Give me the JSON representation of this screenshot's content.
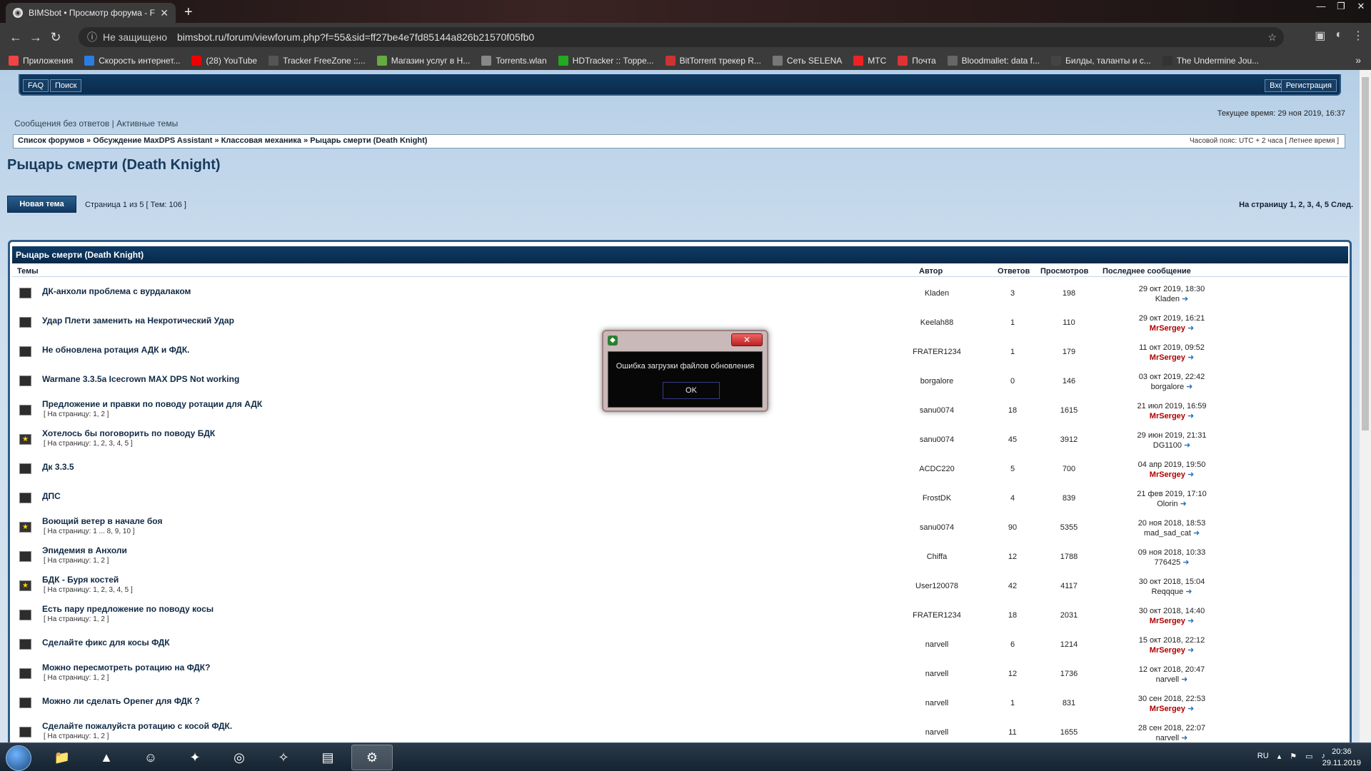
{
  "browser": {
    "tab_title": "BIMSbot • Просмотр форума - F",
    "security": "Не защищено",
    "url": "bimsbot.ru/forum/viewforum.php?f=55&sid=ff27be4e7fd85144a826b21570f05fb0",
    "bookmarks": [
      {
        "label": "Приложения",
        "icon": "apps-icon",
        "color": "#e44"
      },
      {
        "label": "Скорость интернет...",
        "icon": "speed-icon",
        "color": "#2a7de1"
      },
      {
        "label": "(28) YouTube",
        "icon": "youtube-icon",
        "color": "#e00"
      },
      {
        "label": "Tracker FreeZone ::...",
        "icon": "tracker-icon",
        "color": "#555"
      },
      {
        "label": "Магазин услуг в H...",
        "icon": "shop-icon",
        "color": "#6a4"
      },
      {
        "label": "Torrents.wlan",
        "icon": "torrent-icon",
        "color": "#888"
      },
      {
        "label": "HDTracker :: Торре...",
        "icon": "hd-icon",
        "color": "#2a2"
      },
      {
        "label": "BitTorrent трекер R...",
        "icon": "bittorrent-icon",
        "color": "#c33"
      },
      {
        "label": "Сеть SELENA",
        "icon": "selena-icon",
        "color": "#777"
      },
      {
        "label": "МТС",
        "icon": "mts-icon",
        "color": "#e22"
      },
      {
        "label": "Почта",
        "icon": "mail-icon",
        "color": "#d33"
      },
      {
        "label": "Bloodmallet: data f...",
        "icon": "bloodmallet-icon",
        "color": "#666"
      },
      {
        "label": "Билды, таланты и с...",
        "icon": "wg-icon",
        "color": "#444"
      },
      {
        "label": "The Undermine Jou...",
        "icon": "undermine-icon",
        "color": "#333"
      }
    ]
  },
  "forum": {
    "faq": "FAQ",
    "search": "Поиск",
    "login": "Вход",
    "register": "Регистрация",
    "links": "Сообщения без ответов | Активные темы",
    "current_time": "Текущее время: 29 ноя 2019, 16:37",
    "breadcrumb": "Список форумов » Обсуждение MaxDPS Assistant » Классовая механика » Рыцарь смерти (Death Knight)",
    "timezone": "Часовой пояс: UTC + 2 часа [ Летнее время ]",
    "title": "Рыцарь смерти (Death Knight)",
    "new_topic": "Новая тема",
    "page_info": "Страница 1 из 5 [ Тем: 106 ]",
    "pagination": "На страницу 1, 2, 3, 4, 5  След.",
    "box_title": "Рыцарь смерти (Death Knight)",
    "cols": {
      "topics": "Темы",
      "author": "Автор",
      "replies": "Ответов",
      "views": "Просмотров",
      "last": "Последнее сообщение"
    },
    "topics": [
      {
        "title": "ДК-анхоли проблема с вурдалаком",
        "sub": "",
        "author": "Kladen",
        "replies": "3",
        "views": "198",
        "date": "29 окт 2019, 18:30",
        "user": "Kladen",
        "red": false,
        "star": false
      },
      {
        "title": "Удар Плети заменить на Некротический Удар",
        "sub": "",
        "author": "Keelah88",
        "replies": "1",
        "views": "110",
        "date": "29 окт 2019, 16:21",
        "user": "MrSergey",
        "red": true,
        "star": false
      },
      {
        "title": "Не обновлена ротация АДК и ФДК.",
        "sub": "",
        "author": "FRATER1234",
        "replies": "1",
        "views": "179",
        "date": "11 окт 2019, 09:52",
        "user": "MrSergey",
        "red": true,
        "star": false
      },
      {
        "title": "Warmane 3.3.5a Icecrown MAX DPS Not working",
        "sub": "",
        "author": "borgalore",
        "replies": "0",
        "views": "146",
        "date": "03 окт 2019, 22:42",
        "user": "borgalore",
        "red": false,
        "star": false
      },
      {
        "title": "Предложение и правки по поводу ротации для АДК",
        "sub": "[ На страницу: 1, 2 ]",
        "author": "sanu0074",
        "replies": "18",
        "views": "1615",
        "date": "21 июл 2019, 16:59",
        "user": "MrSergey",
        "red": true,
        "star": false
      },
      {
        "title": "Хотелось бы поговорить по поводу БДК",
        "sub": "[ На страницу: 1, 2, 3, 4, 5 ]",
        "author": "sanu0074",
        "replies": "45",
        "views": "3912",
        "date": "29 июн 2019, 21:31",
        "user": "DG1100",
        "red": false,
        "star": true
      },
      {
        "title": "Дк 3.3.5",
        "sub": "",
        "author": "ACDC220",
        "replies": "5",
        "views": "700",
        "date": "04 апр 2019, 19:50",
        "user": "MrSergey",
        "red": true,
        "star": false
      },
      {
        "title": "ДПС",
        "sub": "",
        "author": "FrostDK",
        "replies": "4",
        "views": "839",
        "date": "21 фев 2019, 17:10",
        "user": "Olorin",
        "red": false,
        "star": false
      },
      {
        "title": "Воющий ветер в начале боя",
        "sub": "[ На страницу: 1 ... 8, 9, 10 ]",
        "author": "sanu0074",
        "replies": "90",
        "views": "5355",
        "date": "20 ноя 2018, 18:53",
        "user": "mad_sad_cat",
        "red": false,
        "star": true
      },
      {
        "title": "Эпидемия в Анхоли",
        "sub": "[ На страницу: 1, 2 ]",
        "author": "Chiffa",
        "replies": "12",
        "views": "1788",
        "date": "09 ноя 2018, 10:33",
        "user": "776425",
        "red": false,
        "star": false
      },
      {
        "title": "БДК - Буря костей",
        "sub": "[ На страницу: 1, 2, 3, 4, 5 ]",
        "author": "User120078",
        "replies": "42",
        "views": "4117",
        "date": "30 окт 2018, 15:04",
        "user": "Reqqque",
        "red": false,
        "star": true
      },
      {
        "title": "Есть пару предложение по поводу косы",
        "sub": "[ На страницу: 1, 2 ]",
        "author": "FRATER1234",
        "replies": "18",
        "views": "2031",
        "date": "30 окт 2018, 14:40",
        "user": "MrSergey",
        "red": true,
        "star": false
      },
      {
        "title": "Сделайте фикс для косы ФДК",
        "sub": "",
        "author": "narvell",
        "replies": "6",
        "views": "1214",
        "date": "15 окт 2018, 22:12",
        "user": "MrSergey",
        "red": true,
        "star": false
      },
      {
        "title": "Можно пересмотреть ротацию на ФДК?",
        "sub": "[ На страницу: 1, 2 ]",
        "author": "narvell",
        "replies": "12",
        "views": "1736",
        "date": "12 окт 2018, 20:47",
        "user": "narvell",
        "red": false,
        "star": false
      },
      {
        "title": "Можно ли сделать Opener для ФДК ?",
        "sub": "",
        "author": "narvell",
        "replies": "1",
        "views": "831",
        "date": "30 сен 2018, 22:53",
        "user": "MrSergey",
        "red": true,
        "star": false
      },
      {
        "title": "Сделайте пожалуйста ротацию с косой ФДК.",
        "sub": "[ На страницу: 1, 2 ]",
        "author": "narvell",
        "replies": "11",
        "views": "1655",
        "date": "28 сен 2018, 22:07",
        "user": "narvell",
        "red": false,
        "star": false
      }
    ]
  },
  "dialog": {
    "message": "Ошибка загрузки файлов обновления",
    "ok": "OK"
  },
  "taskbar": {
    "lang": "RU",
    "time": "20:36",
    "date": "29.11.2019"
  }
}
